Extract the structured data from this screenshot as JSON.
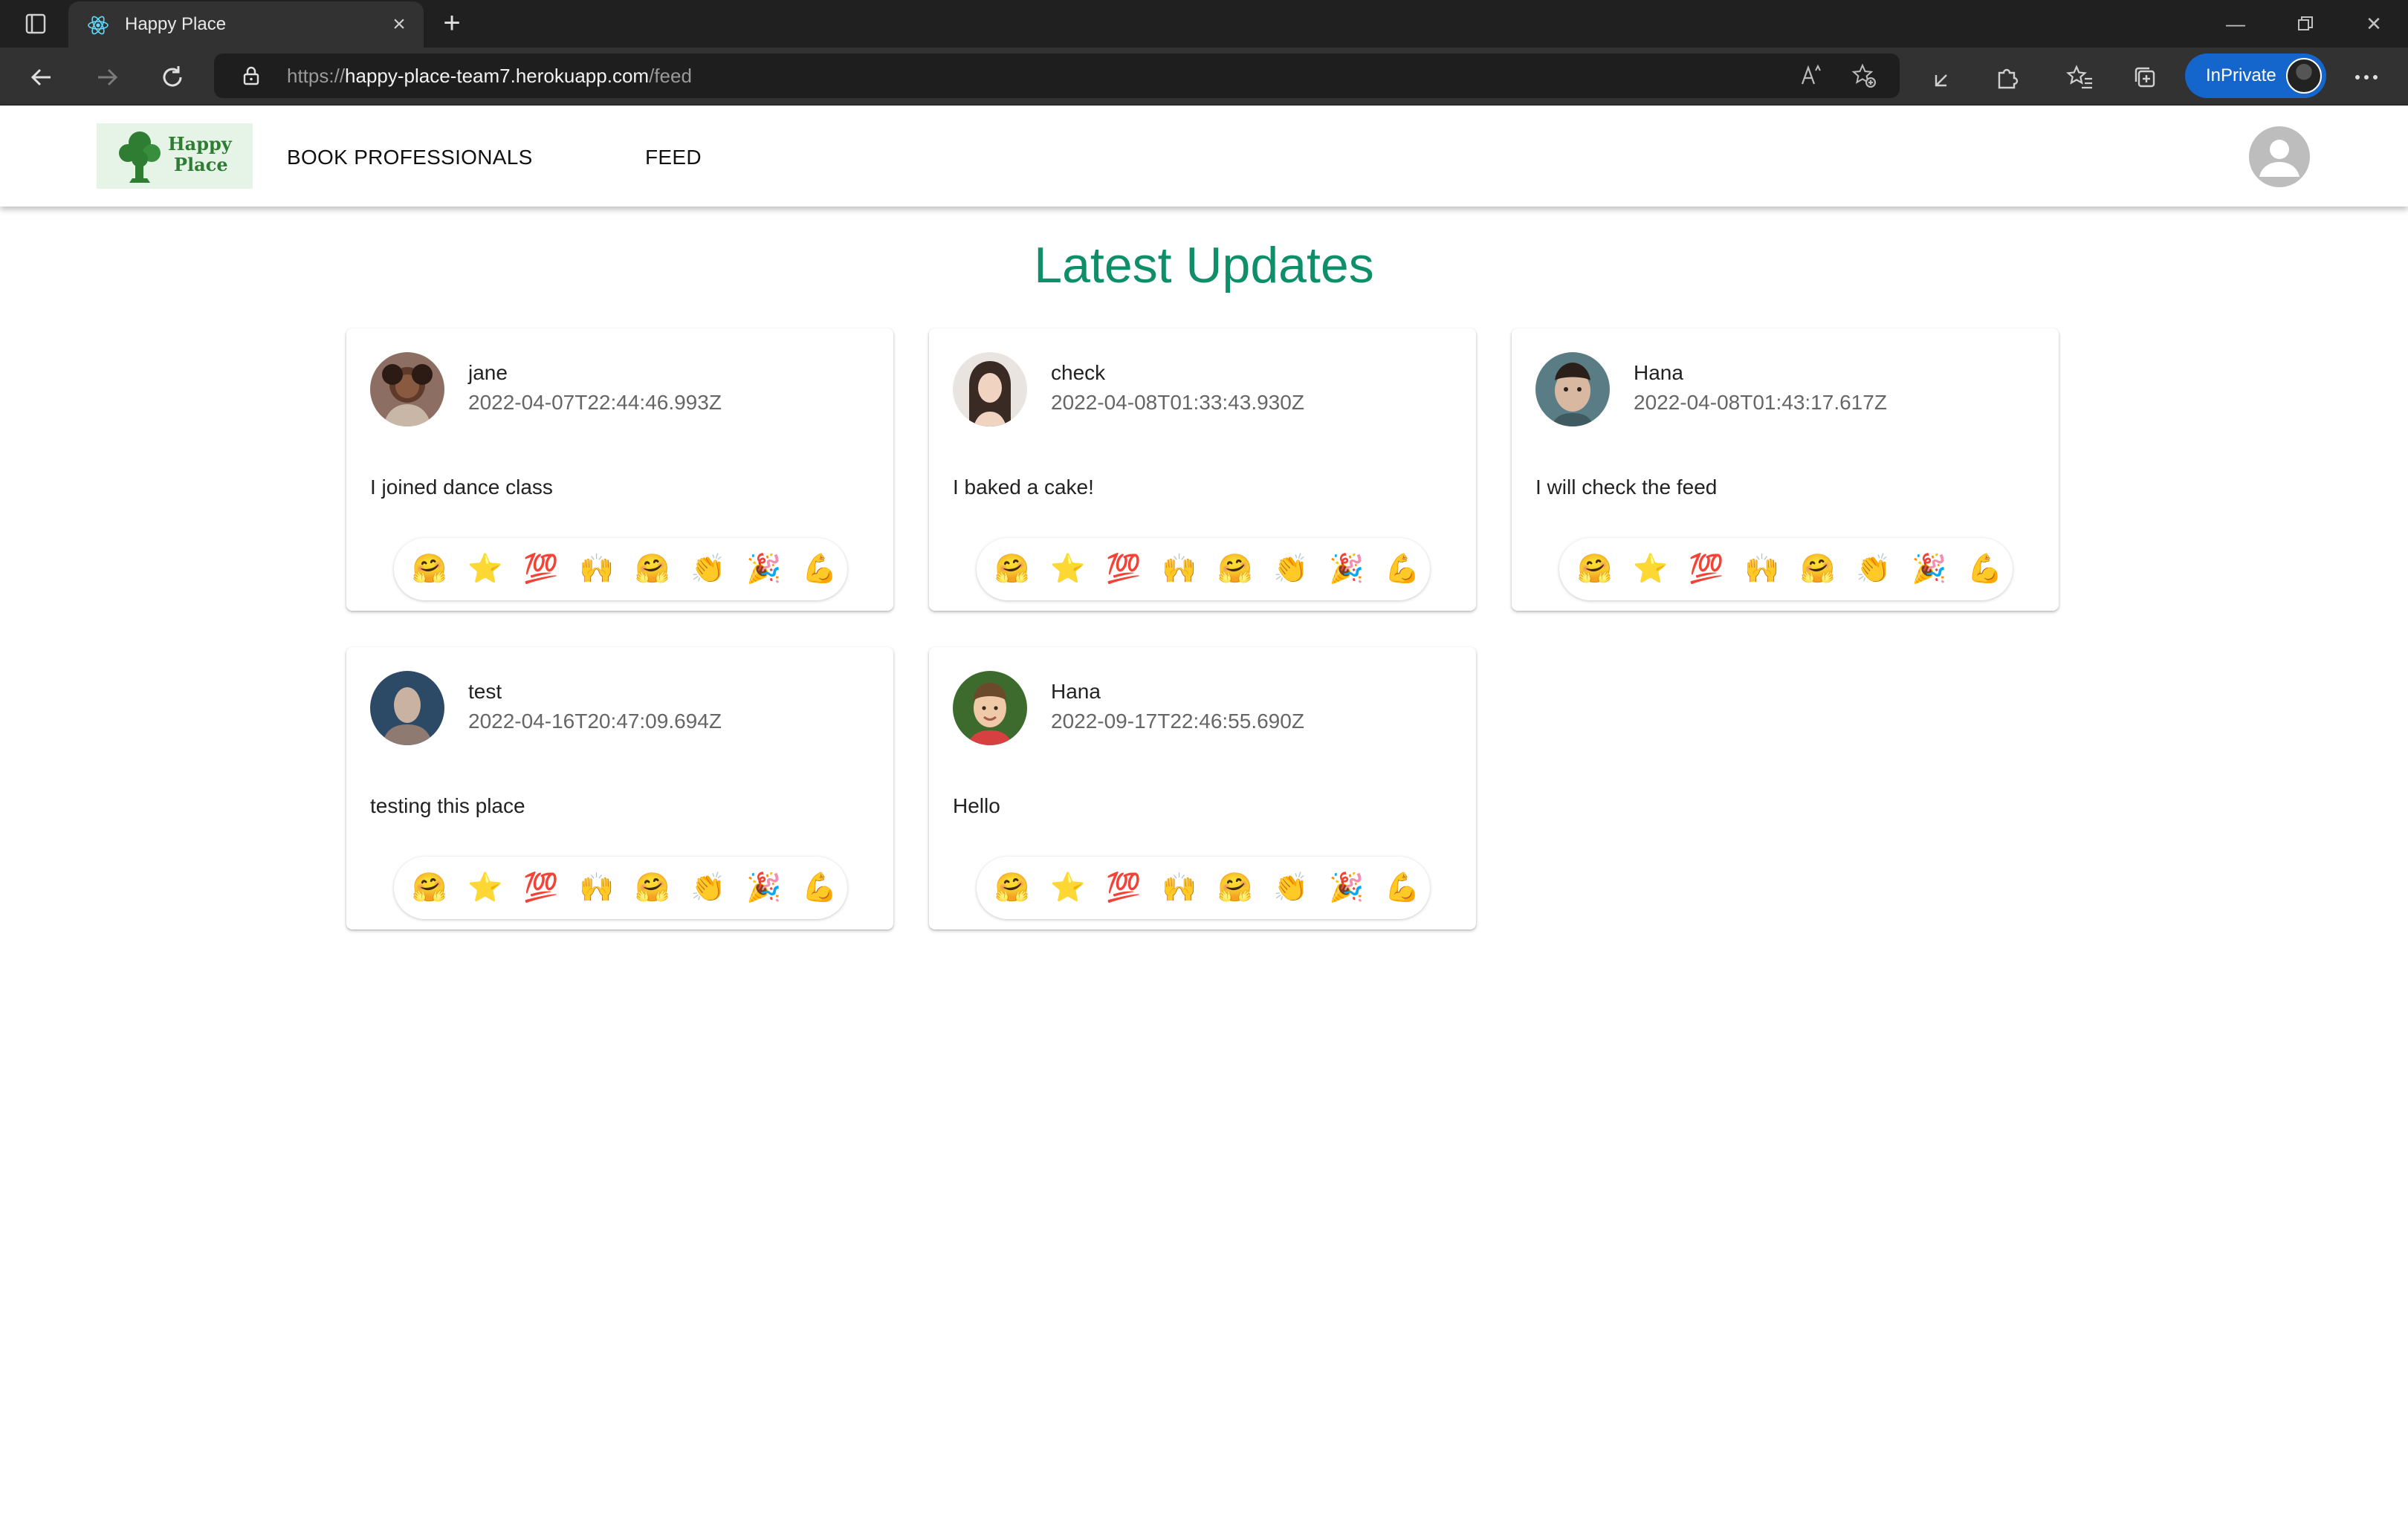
{
  "browser": {
    "tab_title": "Happy Place",
    "url_scheme": "https://",
    "url_host": "happy-place-team7.herokuapp.com",
    "url_path": "/feed",
    "inprivate_label": "InPrivate",
    "accent": "#1466cc"
  },
  "header": {
    "logo_line1": "Happy",
    "logo_line2": "Place",
    "nav": [
      "BOOK PROFESSIONALS",
      "FEED"
    ]
  },
  "feed": {
    "title": "Latest Updates",
    "title_color": "#0e8f6a",
    "posts": [
      {
        "user": "jane",
        "date": "2022-04-07T22:44:46.993Z",
        "text": "I joined dance class",
        "avatar": "girl-portrait"
      },
      {
        "user": "check",
        "date": "2022-04-08T01:33:43.930Z",
        "text": "I baked a cake!",
        "avatar": "woman-portrait"
      },
      {
        "user": "Hana",
        "date": "2022-04-08T01:43:17.617Z",
        "text": "I will check the feed",
        "avatar": "child-portrait"
      },
      {
        "user": "test",
        "date": "2022-04-16T20:47:09.694Z",
        "text": "testing this place",
        "avatar": "man-portrait"
      },
      {
        "user": "Hana",
        "date": "2022-09-17T22:46:55.690Z",
        "text": "Hello",
        "avatar": "boy-portrait"
      }
    ],
    "reactions": [
      {
        "name": "rainbow-hug-reaction",
        "glyph": "🤗"
      },
      {
        "name": "star-reaction",
        "glyph": "⭐"
      },
      {
        "name": "hundred-points-reaction",
        "glyph": "💯"
      },
      {
        "name": "raising-hands-reaction",
        "glyph": "🙌"
      },
      {
        "name": "hugging-face-reaction",
        "glyph": "🤗"
      },
      {
        "name": "clapping-hands-reaction",
        "glyph": "👏"
      },
      {
        "name": "party-popper-reaction",
        "glyph": "🎉"
      },
      {
        "name": "flexed-biceps-reaction",
        "glyph": "💪"
      }
    ]
  }
}
